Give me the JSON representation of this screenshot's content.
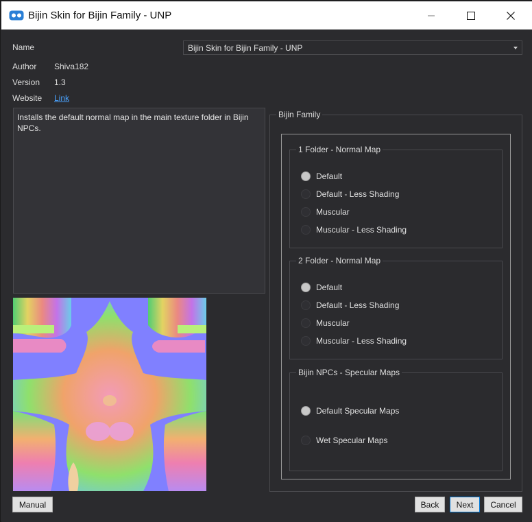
{
  "window": {
    "title": "Bijin Skin for Bijin Family - UNP"
  },
  "info": {
    "name_label": "Name",
    "author_label": "Author",
    "author_value": "Shiva182",
    "version_label": "Version",
    "version_value": "1.3",
    "website_label": "Website",
    "website_link": "Link"
  },
  "plugin_select": {
    "selected": "Bijin Skin for Bijin Family - UNP"
  },
  "description": "Installs the default normal map in the main texture folder in Bijin NPCs.",
  "options": {
    "group_title": "Bijin Family",
    "groups": [
      {
        "title": "1 Folder - Normal Map",
        "items": [
          {
            "label": "Default",
            "checked": true
          },
          {
            "label": "Default - Less Shading",
            "checked": false
          },
          {
            "label": "Muscular",
            "checked": false
          },
          {
            "label": "Muscular - Less Shading",
            "checked": false
          }
        ]
      },
      {
        "title": "2 Folder - Normal Map",
        "items": [
          {
            "label": "Default",
            "checked": true
          },
          {
            "label": "Default - Less Shading",
            "checked": false
          },
          {
            "label": "Muscular",
            "checked": false
          },
          {
            "label": "Muscular - Less Shading",
            "checked": false
          }
        ]
      },
      {
        "title": "Bijin NPCs - Specular Maps",
        "items": [
          {
            "label": "Default Specular Maps",
            "checked": true
          },
          {
            "label": "Wet Specular Maps",
            "checked": false
          }
        ]
      }
    ]
  },
  "buttons": {
    "manual": "Manual",
    "back": "Back",
    "next": "Next",
    "cancel": "Cancel"
  },
  "colors": {
    "background": "#2b2b2e",
    "accent": "#0078d7",
    "link": "#4aa3ff"
  }
}
